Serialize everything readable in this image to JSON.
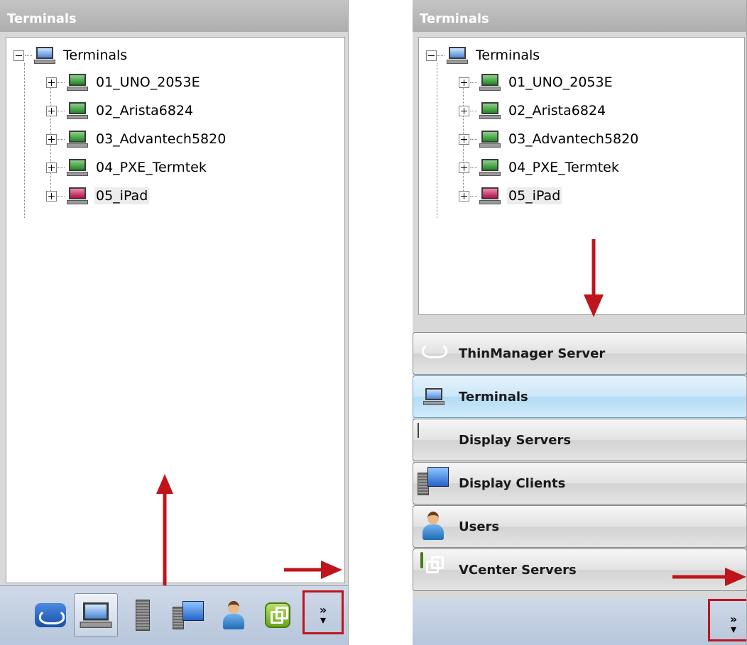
{
  "left": {
    "title": "Terminals",
    "tree": {
      "root": "Terminals",
      "items": [
        "01_UNO_2053E",
        "02_Arista6824",
        "03_Advantech5820",
        "04_PXE_Termtek",
        "05_iPad"
      ]
    },
    "toolbar": {
      "icons": [
        "thinmanager-server-icon",
        "terminals-icon",
        "display-servers-icon",
        "display-clients-icon",
        "users-icon",
        "vcenter-servers-icon"
      ],
      "more": "»",
      "more_arrow": "▾"
    }
  },
  "right": {
    "title": "Terminals",
    "tree": {
      "root": "Terminals",
      "items": [
        "01_UNO_2053E",
        "02_Arista6824",
        "03_Advantech5820",
        "04_PXE_Termtek",
        "05_iPad"
      ]
    },
    "nav": [
      "ThinManager Server",
      "Terminals",
      "Display Servers",
      "Display Clients",
      "Users",
      "VCenter Servers"
    ],
    "more": "»",
    "more_arrow": "▾"
  },
  "colors": {
    "annotation_red": "#c0141c",
    "active_nav": "#b3dbf5",
    "toolbar_blue": "#c3cfe1"
  }
}
